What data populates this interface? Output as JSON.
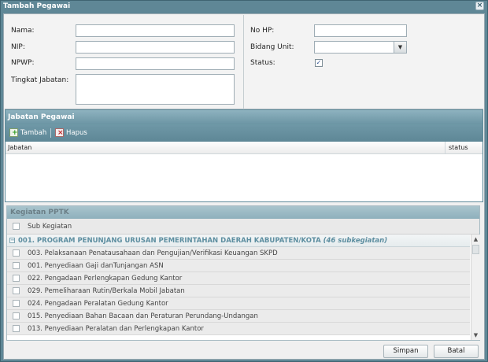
{
  "window": {
    "title": "Tambah Pegawai",
    "close_glyph": "×"
  },
  "form": {
    "nama_label": "Nama:",
    "nip_label": "NIP:",
    "npwp_label": "NPWP:",
    "tingkat_label": "Tingkat Jabatan:",
    "nohp_label": "No HP:",
    "bidang_label": "Bidang Unit:",
    "status_label": "Status:",
    "status_checked": true
  },
  "jabatan": {
    "title": "Jabatan Pegawai",
    "tambah": "Tambah",
    "hapus": "Hapus",
    "columns": [
      "Jabatan",
      "status"
    ]
  },
  "kegiatan": {
    "title": "Kegiatan PPTK",
    "sub_header": "Sub Kegiatan",
    "group_title": "001. PROGRAM PENUNJANG URUSAN PEMERINTAHAN DAERAH KABUPATEN/KOTA",
    "group_count": "(46 subkegiatan)",
    "rows": [
      "003. Pelaksanaan Penatausahaan dan Pengujian/Verifikasi Keuangan SKPD",
      "001. Penyediaan Gaji danTunjangan ASN",
      "022. Pengadaan Perlengkapan Gedung Kantor",
      "029. Pemeliharaan Rutin/Berkala Mobil Jabatan",
      "024. Pengadaan Peralatan Gedung Kantor",
      "015. Penyediaan Bahan Bacaan dan Peraturan Perundang-Undangan",
      "013. Penyediaan Peralatan dan Perlengkapan Kantor"
    ]
  },
  "footer": {
    "simpan": "Simpan",
    "batal": "Batal"
  },
  "icons": {
    "add": "add-icon",
    "delete": "delete-icon",
    "dropdown": "chevron-down-icon",
    "collapse": "collapse-icon"
  }
}
